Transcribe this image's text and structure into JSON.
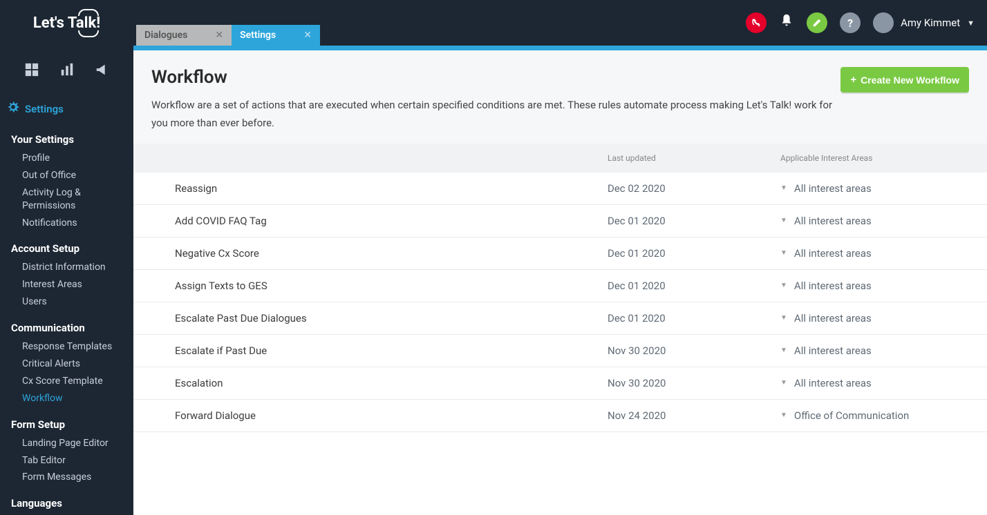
{
  "logo": "Let's Talk!",
  "tabs": [
    {
      "label": "Dialogues",
      "active": false
    },
    {
      "label": "Settings",
      "active": true
    }
  ],
  "user_name": "Amy Kimmet",
  "sidebar": {
    "settings_label": "Settings",
    "groups": [
      {
        "title": "Your Settings",
        "items": [
          "Profile",
          "Out of Office",
          "Activity Log & Permissions",
          "Notifications"
        ]
      },
      {
        "title": "Account Setup",
        "items": [
          "District Information",
          "Interest Areas",
          "Users"
        ]
      },
      {
        "title": "Communication",
        "items": [
          "Response Templates",
          "Critical Alerts",
          "Cx Score Template",
          "Workflow"
        ]
      },
      {
        "title": "Form Setup",
        "items": [
          "Landing Page Editor",
          "Tab Editor",
          "Form Messages"
        ]
      },
      {
        "title": "Languages",
        "items": []
      }
    ],
    "active_item": "Workflow"
  },
  "page": {
    "title": "Workflow",
    "description": "Workflow are a set of actions that are executed when certain specified conditions are met. These rules automate process making Let's Talk! work for you more than ever before.",
    "create_button": "Create New Workflow"
  },
  "columns": {
    "updated": "Last updated",
    "areas": "Applicable Interest Areas"
  },
  "rows": [
    {
      "name": "Reassign",
      "updated": "Dec 02 2020",
      "areas": "All interest areas"
    },
    {
      "name": "Add COVID FAQ Tag",
      "updated": "Dec 01 2020",
      "areas": "All interest areas"
    },
    {
      "name": "Negative Cx Score",
      "updated": "Dec 01 2020",
      "areas": "All interest areas"
    },
    {
      "name": "Assign Texts to GES",
      "updated": "Dec 01 2020",
      "areas": "All interest areas"
    },
    {
      "name": "Escalate Past Due Dialogues",
      "updated": "Dec 01 2020",
      "areas": "All interest areas"
    },
    {
      "name": "Escalate if Past Due",
      "updated": "Nov 30 2020",
      "areas": "All interest areas"
    },
    {
      "name": "Escalation",
      "updated": "Nov 30 2020",
      "areas": "All interest areas"
    },
    {
      "name": "Forward Dialogue",
      "updated": "Nov 24 2020",
      "areas": "Office of Communication"
    }
  ]
}
